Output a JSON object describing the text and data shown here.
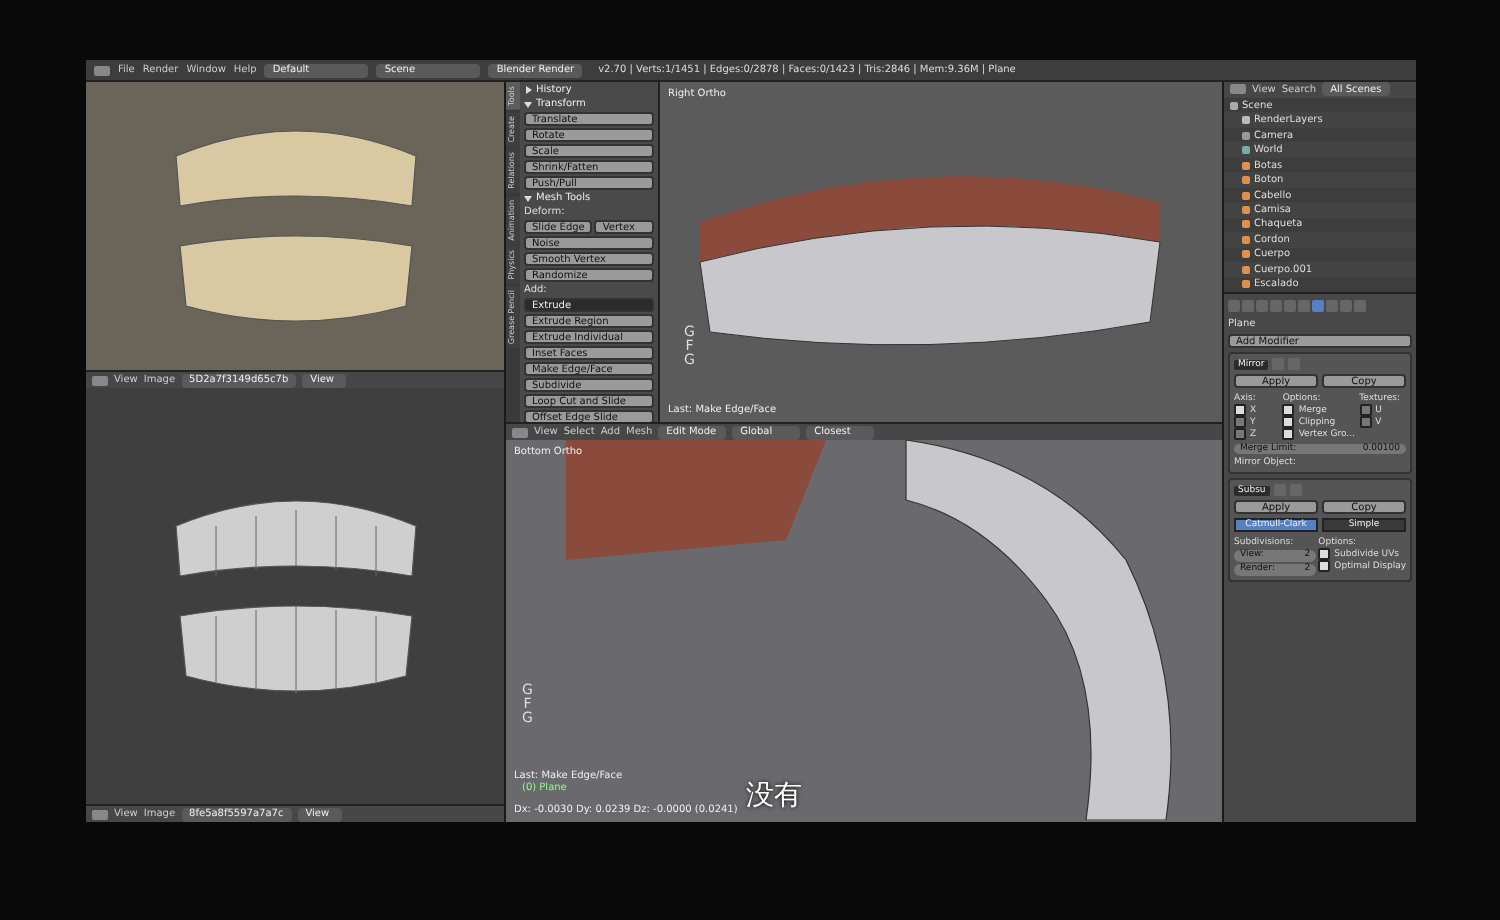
{
  "menubar": {
    "menus": [
      "File",
      "Render",
      "Window",
      "Help"
    ],
    "layout": "Default",
    "scene": "Scene",
    "engine": "Blender Render",
    "stats": "v2.70 | Verts:1/1451 | Edges:0/2878 | Faces:0/1423 | Tris:2846 | Mem:9.36M | Plane"
  },
  "image_editors": [
    {
      "kind": "textured",
      "menus": [
        "View",
        "Image"
      ],
      "image_name": "5D2a7f3149d65c7b",
      "view": "View"
    },
    {
      "kind": "wireframe",
      "menus": [
        "View",
        "Image"
      ],
      "image_name": "8fe5a8f5597a7a7c",
      "view": "View"
    }
  ],
  "tool_shelf": {
    "tabs": [
      {
        "label": "Tools",
        "selected": true
      },
      {
        "label": "Create",
        "selected": false
      },
      {
        "label": "Relations",
        "selected": false
      },
      {
        "label": "Animation",
        "selected": false
      },
      {
        "label": "Physics",
        "selected": false
      },
      {
        "label": "Grease Pencil",
        "selected": false
      }
    ],
    "panels": [
      {
        "title": "History",
        "expanded": false
      },
      {
        "title": "Transform",
        "expanded": true,
        "items": [
          {
            "kind": "button",
            "label": "Translate"
          },
          {
            "kind": "button",
            "label": "Rotate"
          },
          {
            "kind": "button",
            "label": "Scale"
          },
          {
            "kind": "button",
            "label": "Shrink/Fatten"
          },
          {
            "kind": "button",
            "label": "Push/Pull"
          }
        ]
      },
      {
        "title": "Mesh Tools",
        "expanded": true,
        "items": [
          {
            "kind": "label",
            "label": "Deform:"
          },
          {
            "kind": "pair",
            "label": "Slide Edge",
            "second": "Vertex"
          },
          {
            "kind": "button",
            "label": "Noise"
          },
          {
            "kind": "button",
            "label": "Smooth Vertex"
          },
          {
            "kind": "button",
            "label": "Randomize"
          },
          {
            "kind": "label",
            "label": "Add:"
          },
          {
            "kind": "dropdown",
            "label": "Extrude"
          },
          {
            "kind": "button",
            "label": "Extrude Region"
          },
          {
            "kind": "button",
            "label": "Extrude Individual"
          },
          {
            "kind": "button",
            "label": "Inset Faces"
          },
          {
            "kind": "button",
            "label": "Make Edge/Face"
          },
          {
            "kind": "button",
            "label": "Subdivide"
          },
          {
            "kind": "button",
            "label": "Loop Cut and Slide"
          },
          {
            "kind": "button",
            "label": "Offset Edge Slide"
          }
        ]
      }
    ]
  },
  "viewport_top": {
    "view_name": "Right Ortho",
    "keys": [
      "G",
      "F",
      "G"
    ],
    "last_operator": "Last: Make Edge/Face"
  },
  "viewport_bottom": {
    "menus": [
      "View",
      "Select",
      "Add",
      "Mesh"
    ],
    "mode": "Edit Mode",
    "orientation": "Global",
    "snap": "Closest",
    "view_name": "Bottom Ortho",
    "keys": [
      "G",
      "F",
      "G"
    ],
    "last_operator": "Last: Make Edge/Face",
    "object": "(0) Plane",
    "readout": "Dx: -0.0030  Dy: 0.0239  Dz: -0.0000 (0.0241)",
    "subtitle": "没有"
  },
  "outliner": {
    "menus": [
      "View",
      "Search"
    ],
    "filter": "All Scenes",
    "tree": [
      {
        "name": "Scene",
        "kind": "scene",
        "children": [
          {
            "name": "RenderLayers",
            "kind": "layers"
          },
          {
            "name": "Camera",
            "kind": "camera"
          },
          {
            "name": "World",
            "kind": "world"
          },
          {
            "name": "Botas",
            "kind": "object"
          },
          {
            "name": "Boton",
            "kind": "object"
          },
          {
            "name": "Cabello",
            "kind": "object"
          },
          {
            "name": "Camisa",
            "kind": "object"
          },
          {
            "name": "Chaqueta",
            "kind": "object"
          },
          {
            "name": "Cordon",
            "kind": "object"
          },
          {
            "name": "Cuerpo",
            "kind": "object"
          },
          {
            "name": "Cuerpo.001",
            "kind": "object"
          },
          {
            "name": "Escalado",
            "kind": "object"
          }
        ]
      }
    ]
  },
  "properties": {
    "context": "Plane",
    "add_modifier": "Add Modifier",
    "modifiers": [
      {
        "kind": "mirror",
        "name": "Mirror",
        "apply": "Apply",
        "copy": "Copy",
        "columns": [
          {
            "label": "Axis:",
            "items": [
              {
                "label": "X",
                "checked": true
              },
              {
                "label": "Y",
                "checked": false
              },
              {
                "label": "Z",
                "checked": false
              }
            ]
          },
          {
            "label": "Options:",
            "items": [
              {
                "label": "Merge",
                "checked": true
              },
              {
                "label": "Clipping",
                "checked": true
              },
              {
                "label": "Vertex Gro...",
                "checked": true
              }
            ]
          },
          {
            "label": "Textures:",
            "items": [
              {
                "label": "U",
                "checked": false
              },
              {
                "label": "V",
                "checked": false
              }
            ]
          }
        ],
        "merge_label": "Merge Limit:",
        "merge_value": "0.00100",
        "mirror_object": "Mirror Object:"
      },
      {
        "kind": "subsurf",
        "name": "Subsu",
        "apply": "Apply",
        "copy": "Copy",
        "types": [
          {
            "label": "Catmull-Clark",
            "selected": true
          },
          {
            "label": "Simple",
            "selected": false
          }
        ],
        "subdivisions": "Subdivisions:",
        "fields": [
          {
            "label": "View:",
            "value": "2"
          },
          {
            "label": "Render:",
            "value": "2"
          }
        ],
        "options_label": "Options:",
        "options": [
          {
            "label": "Subdivide UVs",
            "checked": true
          },
          {
            "label": "Optimal Display",
            "checked": true
          }
        ]
      }
    ]
  }
}
